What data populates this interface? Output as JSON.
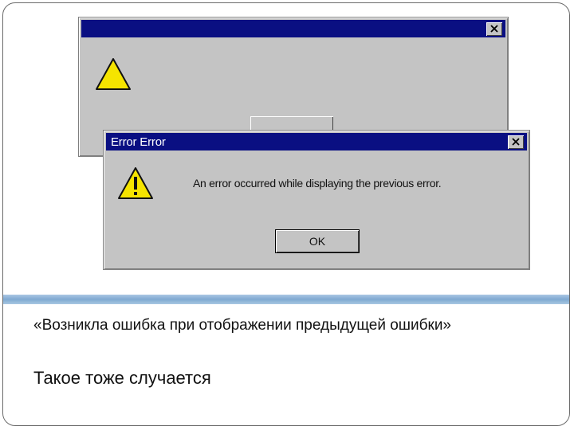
{
  "background_dialog": {
    "title": "",
    "button_label": ""
  },
  "front_dialog": {
    "title": "Error Error",
    "message": "An error occurred while displaying the previous error.",
    "ok_label": "OK"
  },
  "caption": "«Возникла ошибка при отображении предыдущей ошибки»",
  "subcaption": "Такое тоже случается",
  "colors": {
    "titlebar": "#0a0f82",
    "window_face": "#c4c4c4",
    "divider": "#7fa9d1",
    "warning_yellow": "#f5e400"
  },
  "icons": {
    "close": "close-x-icon",
    "warning": "warning-triangle-icon"
  }
}
